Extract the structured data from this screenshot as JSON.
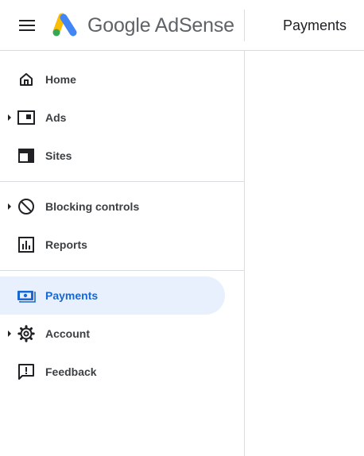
{
  "app": {
    "name": "Google AdSense",
    "page_title": "Payments",
    "brand_colors": {
      "yellow": "#fbbc04",
      "green": "#34a853",
      "blue": "#4285f4",
      "active_bg": "#e8f0fe",
      "active_text": "#1967d2"
    }
  },
  "sidebar": {
    "items": [
      {
        "label": "Home",
        "icon": "home-icon",
        "expandable": false,
        "active": false
      },
      {
        "label": "Ads",
        "icon": "ads-icon",
        "expandable": true,
        "active": false
      },
      {
        "label": "Sites",
        "icon": "sites-icon",
        "expandable": false,
        "active": false
      },
      {
        "label": "Blocking controls",
        "icon": "block-icon",
        "expandable": true,
        "active": false
      },
      {
        "label": "Reports",
        "icon": "reports-icon",
        "expandable": false,
        "active": false
      },
      {
        "label": "Payments",
        "icon": "payments-icon",
        "expandable": false,
        "active": true
      },
      {
        "label": "Account",
        "icon": "settings-icon",
        "expandable": true,
        "active": false
      },
      {
        "label": "Feedback",
        "icon": "feedback-icon",
        "expandable": false,
        "active": false
      }
    ]
  }
}
